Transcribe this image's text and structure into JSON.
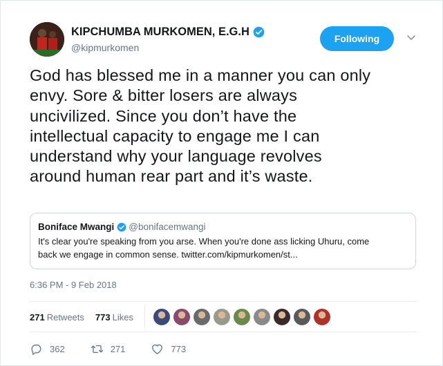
{
  "profile": {
    "display_name": "KIPCHUMBA MURKOMEN, E.G.H",
    "handle": "@kipmurkomen",
    "follow_label": "Following"
  },
  "tweet": {
    "lines": [
      "God has blessed me in a manner you can only",
      "envy. Sore & bitter losers are always",
      "uncivilized. Since you don’t have the",
      "intellectual capacity to engage me I can",
      "understand why your language revolves",
      "around human rear part and it’s waste."
    ]
  },
  "quote": {
    "name": "Boniface Mwangi",
    "handle": "@bonifacemwangi",
    "line1": "It's clear you're speaking from you arse. When you're done ass licking Uhuru, come",
    "line2": "back we engage in common sense. twitter.com/kipmurkomen/st..."
  },
  "timestamp": "6:36 PM - 9 Feb 2018",
  "stats": {
    "retweets_count": "271",
    "retweets_label": "Retweets",
    "likes_count": "773",
    "likes_label": "Likes"
  },
  "likers": [
    {
      "name": "liker-avatar-1",
      "color": "#3a4a7a"
    },
    {
      "name": "liker-avatar-2",
      "color": "#8a4a6a"
    },
    {
      "name": "liker-avatar-3",
      "color": "#6a6a6a"
    },
    {
      "name": "liker-avatar-4",
      "color": "#9a9a8a"
    },
    {
      "name": "liker-avatar-5",
      "color": "#6a8a4a"
    },
    {
      "name": "liker-avatar-6",
      "color": "#8a8a8a"
    },
    {
      "name": "liker-avatar-7",
      "color": "#3a2a2a"
    },
    {
      "name": "liker-avatar-8",
      "color": "#5a5a5a"
    },
    {
      "name": "liker-avatar-9",
      "color": "#b0302a"
    }
  ],
  "actions": {
    "replies": "362",
    "retweets": "271",
    "likes": "773"
  },
  "colors": {
    "accent": "#1da1f2",
    "text": "#14171a",
    "muted": "#657786",
    "border": "#e6ecf0"
  },
  "icons": {
    "verified": "verified-badge-icon",
    "chevron": "chevron-down-icon",
    "reply": "reply-icon",
    "retweet": "retweet-icon",
    "like": "heart-icon"
  }
}
